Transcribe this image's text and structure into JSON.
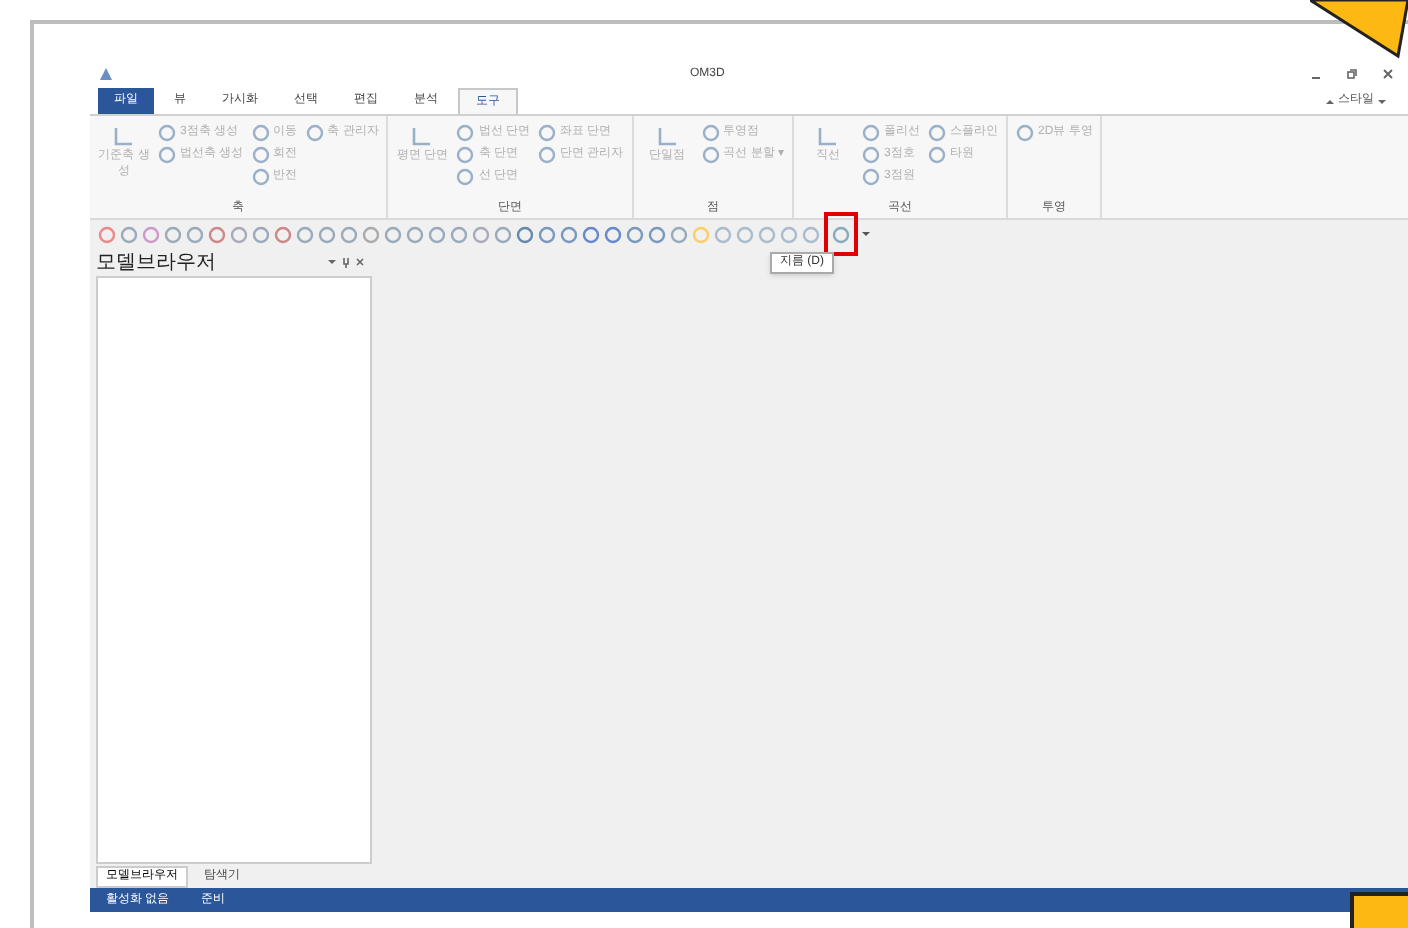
{
  "window": {
    "title": "OM3D"
  },
  "tabs": [
    {
      "label": "파일",
      "kind": "file",
      "selected": false
    },
    {
      "label": "뷰",
      "kind": "tab",
      "selected": false
    },
    {
      "label": "가시화",
      "kind": "tab",
      "selected": false
    },
    {
      "label": "선택",
      "kind": "tab",
      "selected": false
    },
    {
      "label": "편집",
      "kind": "tab",
      "selected": false
    },
    {
      "label": "분석",
      "kind": "tab",
      "selected": false
    },
    {
      "label": "도구",
      "kind": "tab",
      "selected": true
    }
  ],
  "style_menu": {
    "label": "스타일"
  },
  "ribbon_groups": [
    {
      "label": "축",
      "large": {
        "label": "기준축 생성"
      },
      "columns": [
        [
          "3점축 생성",
          "법선축 생성"
        ],
        [
          "이동",
          "회전",
          "반전"
        ],
        [
          "축 관리자"
        ]
      ]
    },
    {
      "label": "단면",
      "large": {
        "label": "평면 단면"
      },
      "columns": [
        [
          "법선 단면",
          "축 단면",
          "선 단면"
        ],
        [
          "좌표 단면",
          "단면 관리자"
        ]
      ]
    },
    {
      "label": "점",
      "large": {
        "label": "단일점"
      },
      "columns": [
        [
          "투영점",
          "곡선 분할 ▾"
        ]
      ]
    },
    {
      "label": "곡선",
      "large": {
        "label": "직선"
      },
      "columns": [
        [
          "폴리선",
          "3점호",
          "3점원"
        ],
        [
          "스플라인",
          "타원"
        ]
      ]
    },
    {
      "label": "투영",
      "columns": [
        [
          "2D뷰 투영"
        ]
      ]
    }
  ],
  "tooltip": {
    "label": "지름 (D)"
  },
  "browser": {
    "title": "모델브라우저",
    "bottom_tabs": [
      {
        "label": "모델브라우저",
        "selected": true
      },
      {
        "label": "탐색기",
        "selected": false
      }
    ]
  },
  "status_bar": {
    "items": [
      "활성화 없음",
      "준비"
    ]
  }
}
